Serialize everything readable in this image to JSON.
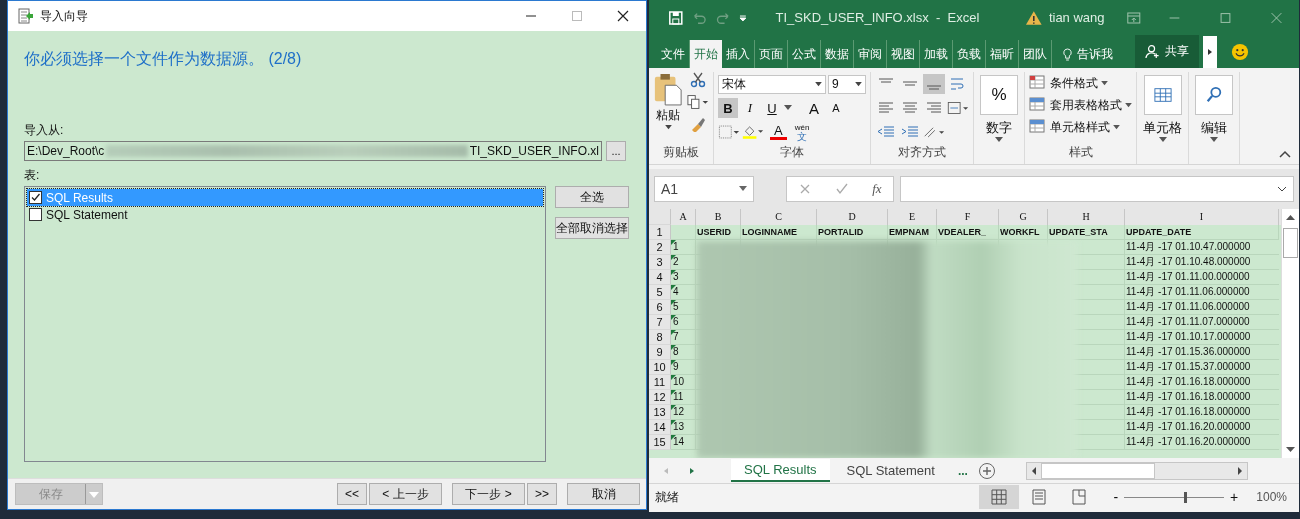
{
  "dialog": {
    "title": "导入向导",
    "heading": "你必须选择一个文件作为数据源。 (2/8)",
    "source_label": "导入从:",
    "path_start": "E:\\Dev_Root\\c",
    "path_end": "TI_SKD_USER_INFO.xl",
    "browse_button": "...",
    "tables_label": "表:",
    "tables": [
      {
        "label": "SQL Results",
        "checked": true,
        "selected": true
      },
      {
        "label": "SQL Statement",
        "checked": false,
        "selected": false
      }
    ],
    "select_all": "全选",
    "deselect_all": "全部取消选择",
    "save": {
      "label": "保存",
      "disabled": true
    },
    "nav_buttons": [
      "<<",
      "< 上一步",
      "下一步 >",
      ">>"
    ],
    "cancel": "取消"
  },
  "excel": {
    "title": "TI_SKD_USER_INFO.xlsx  -  Excel",
    "user": "tian wang",
    "tabs": [
      {
        "label": "文件",
        "selected": false
      },
      {
        "label": "开始",
        "selected": true
      },
      {
        "label": "插入",
        "selected": false
      },
      {
        "label": "页面",
        "selected": false
      },
      {
        "label": "公式",
        "selected": false
      },
      {
        "label": "数据",
        "selected": false
      },
      {
        "label": "审阅",
        "selected": false
      },
      {
        "label": "视图",
        "selected": false
      },
      {
        "label": "加载",
        "selected": false
      },
      {
        "label": "负载",
        "selected": false
      },
      {
        "label": "福昕",
        "selected": false
      },
      {
        "label": "团队",
        "selected": false
      }
    ],
    "tell_me": "告诉我",
    "share": "共享",
    "ribbon": {
      "paste": "粘贴",
      "clipboard_group": "剪贴板",
      "font_name": "宋体",
      "font_size": "9",
      "bold": {
        "label": "B",
        "on": true
      },
      "italic": "I",
      "underline": "U",
      "grow": "A",
      "shrink": "A",
      "font_color": "A",
      "phonetic_top": "wén",
      "phonetic_bottom": "文",
      "font_group": "字体",
      "align_top": [
        {
          "on": false
        },
        {
          "on": false
        },
        {
          "on": true
        }
      ],
      "align_group": "对齐方式",
      "percent": "%",
      "number": "数字",
      "styles": [
        "条件格式",
        "套用表格格式",
        "单元格样式"
      ],
      "styles_group": "样式",
      "cells": "单元格",
      "editing": "编辑"
    },
    "name_box": "A1",
    "fx": "fx",
    "columns": [
      "A",
      "B",
      "C",
      "D",
      "E",
      "F",
      "G",
      "H",
      "I"
    ],
    "headers": [
      "USERID",
      "LOGINNAME",
      "PORTALID",
      "EMPNAM",
      "VDEALER_",
      "WORKFL",
      "UPDATE_STA",
      "UPDATE_DATE"
    ],
    "rows": [
      {
        "num": "2",
        "id": "1",
        "date": "11-4月 -17 01.10.47.000000"
      },
      {
        "num": "3",
        "id": "2",
        "date": "11-4月 -17 01.10.48.000000"
      },
      {
        "num": "4",
        "id": "3",
        "date": "11-4月 -17 01.11.00.000000"
      },
      {
        "num": "5",
        "id": "4",
        "date": "11-4月 -17 01.11.06.000000"
      },
      {
        "num": "6",
        "id": "5",
        "date": "11-4月 -17 01.11.06.000000"
      },
      {
        "num": "7",
        "id": "6",
        "date": "11-4月 -17 01.11.07.000000"
      },
      {
        "num": "8",
        "id": "7",
        "date": "11-4月 -17 01.10.17.000000"
      },
      {
        "num": "9",
        "id": "8",
        "date": "11-4月 -17 01.15.36.000000"
      },
      {
        "num": "10",
        "id": "9",
        "date": "11-4月 -17 01.15.37.000000"
      },
      {
        "num": "11",
        "id": "10",
        "date": "11-4月 -17 01.16.18.000000"
      },
      {
        "num": "12",
        "id": "11",
        "date": "11-4月 -17 01.16.18.000000"
      },
      {
        "num": "13",
        "id": "12",
        "date": "11-4月 -17 01.16.18.000000"
      },
      {
        "num": "14",
        "id": "13",
        "date": "11-4月 -17 01.16.20.000000"
      },
      {
        "num": "15",
        "id": "14",
        "date": "11-4月 -17 01.16.20.000000"
      }
    ],
    "header_row_num": "1",
    "sheets": [
      {
        "label": "SQL Results",
        "selected": true
      },
      {
        "label": "SQL Statement",
        "selected": false
      }
    ],
    "more_sheets": "...",
    "status": "就绪",
    "views": [
      {
        "kind": "normal",
        "selected": true
      },
      {
        "kind": "layout",
        "selected": false
      },
      {
        "kind": "break",
        "selected": false
      }
    ],
    "zoom": {
      "level": 0.6,
      "reading": "100%",
      "minus": "-",
      "plus": "+"
    }
  }
}
